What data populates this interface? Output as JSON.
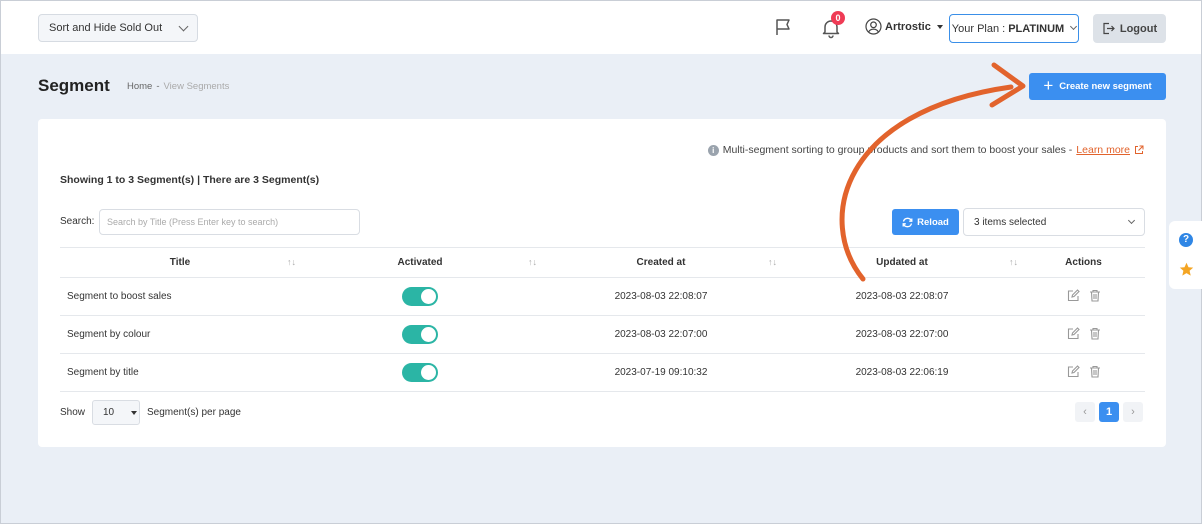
{
  "header": {
    "app_select": "Sort and Hide Sold Out",
    "notification_count": "0",
    "user_name": "Artrostic",
    "plan_label": "Your Plan :",
    "plan_value": "PLATINUM",
    "logout_label": "Logout"
  },
  "page": {
    "title": "Segment",
    "breadcrumb_home": "Home",
    "breadcrumb_sep": "-",
    "breadcrumb_current": "View Segments",
    "create_button": "Create new segment"
  },
  "card": {
    "info_text": "Multi-segment sorting to group products and sort them to boost your sales -",
    "learn_more": "Learn more",
    "showing": "Showing 1 to 3 Segment(s) | There are 3 Segment(s)",
    "search_label": "Search:",
    "search_placeholder": "Search by Title (Press Enter key to search)",
    "reload_label": "Reload",
    "items_selected": "3 items selected"
  },
  "table": {
    "headers": [
      "Title",
      "Activated",
      "Created at",
      "Updated at",
      "Actions"
    ],
    "rows": [
      {
        "title": "Segment to boost sales",
        "activated": true,
        "created": "2023-08-03 22:08:07",
        "updated": "2023-08-03 22:08:07"
      },
      {
        "title": "Segment by colour",
        "activated": true,
        "created": "2023-08-03 22:07:00",
        "updated": "2023-08-03 22:07:00"
      },
      {
        "title": "Segment by title",
        "activated": true,
        "created": "2023-07-19 09:10:32",
        "updated": "2023-08-03 22:06:19"
      }
    ]
  },
  "footer": {
    "show_label": "Show",
    "per_page_value": "10",
    "per_page_label": "Segment(s) per page",
    "current_page": "1"
  },
  "colors": {
    "primary": "#3b8ff0",
    "toggle_on": "#2bb5a5",
    "annotation_arrow": "#e2632c",
    "badge": "#ef3b55"
  }
}
